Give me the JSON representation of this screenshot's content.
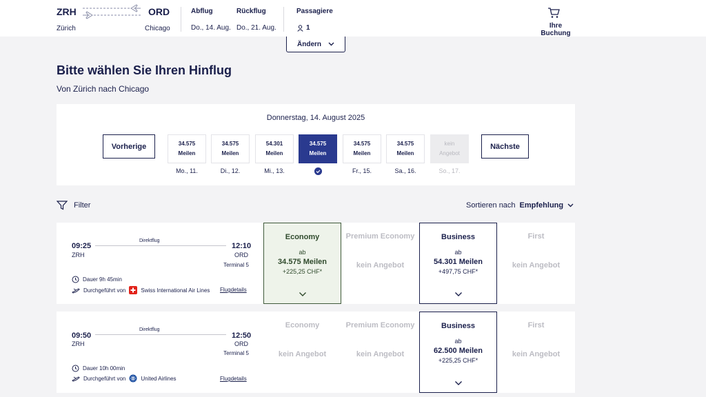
{
  "header": {
    "origin_code": "ZRH",
    "origin_city": "Zürich",
    "dest_code": "ORD",
    "dest_city": "Chicago",
    "depart_label": "Abflug",
    "depart_date": "Do., 14. Aug.",
    "return_label": "Rückflug",
    "return_date": "Do., 21. Aug.",
    "pax_label": "Passagiere",
    "pax_count": "1",
    "booking_label": "Ihre Buchung",
    "change_label": "Ändern"
  },
  "page": {
    "title": "Bitte wählen Sie Ihren Hinflug",
    "subtitle": "Von Zürich nach Chicago"
  },
  "dates": {
    "heading": "Donnerstag, 14. August 2025",
    "prev_label": "Vorherige",
    "next_label": "Nächste",
    "days": [
      {
        "miles": "34.575",
        "unit": "Meilen",
        "label": "Mo., 11."
      },
      {
        "miles": "34.575",
        "unit": "Meilen",
        "label": "Di., 12."
      },
      {
        "miles": "54.301",
        "unit": "Meilen",
        "label": "Mi., 13."
      },
      {
        "miles": "34.575",
        "unit": "Meilen",
        "label": ""
      },
      {
        "miles": "34.575",
        "unit": "Meilen",
        "label": "Fr., 15."
      },
      {
        "miles": "34.575",
        "unit": "Meilen",
        "label": "Sa., 16."
      },
      {
        "miles": "kein",
        "unit": "Angebot",
        "label": "So., 17."
      }
    ]
  },
  "toolbar": {
    "filter_label": "Filter",
    "sort_prefix": "Sortieren nach",
    "sort_value": "Empfehlung"
  },
  "flights": [
    {
      "dep_time": "09:25",
      "dep_code": "ZRH",
      "arr_time": "12:10",
      "arr_code": "ORD",
      "type": "Direktflug",
      "terminal": "Terminal 5",
      "duration": "Dauer 9h 45min",
      "operated_prefix": "Durchgeführt von",
      "airline": "Swiss International Air Lines",
      "details_link": "Flugdetails",
      "fares": {
        "economy": {
          "name": "Economy",
          "ab": "ab",
          "miles": "34.575 Meilen",
          "chf": "+225,25 CHF*"
        },
        "premium": {
          "name": "Premium Economy",
          "none": "kein Angebot"
        },
        "business": {
          "name": "Business",
          "ab": "ab",
          "miles": "54.301 Meilen",
          "chf": "+497,75 CHF*"
        },
        "first": {
          "name": "First",
          "none": "kein Angebot"
        }
      }
    },
    {
      "dep_time": "09:50",
      "dep_code": "ZRH",
      "arr_time": "12:50",
      "arr_code": "ORD",
      "type": "Direktflug",
      "terminal": "Terminal 5",
      "duration": "Dauer 10h 00min",
      "operated_prefix": "Durchgeführt von",
      "airline": "United Airlines",
      "details_link": "Flugdetails",
      "fares": {
        "economy": {
          "name": "Economy",
          "none": "kein Angebot"
        },
        "premium": {
          "name": "Premium Economy",
          "none": "kein Angebot"
        },
        "business": {
          "name": "Business",
          "ab": "ab",
          "miles": "62.500 Meilen",
          "chf": "+225,25 CHF*"
        },
        "first": {
          "name": "First",
          "none": "kein Angebot"
        }
      }
    }
  ],
  "colors": {
    "navy": "#1a1f4b",
    "selected": "#2a3a8f",
    "economy_bg": "#eef3ea",
    "swiss_red": "#e2231a",
    "united_blue": "#1c4fa1"
  }
}
